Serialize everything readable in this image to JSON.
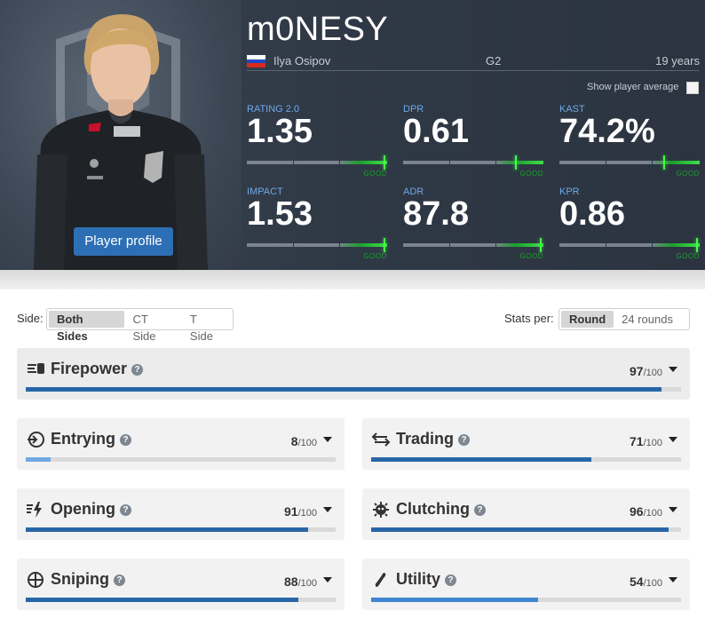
{
  "player": {
    "nickname": "m0NESY",
    "real_name": "Ilya Osipov",
    "team": "G2",
    "age": "19 years",
    "profile_button": "Player profile",
    "show_average_label": "Show player average"
  },
  "stats": [
    {
      "label": "RATING 2.0",
      "value": "1.35",
      "badge": "GOOD",
      "level": 0.99
    },
    {
      "label": "DPR",
      "value": "0.61",
      "badge": "GOOD",
      "level": 0.81
    },
    {
      "label": "KAST",
      "value": "74.2%",
      "badge": "GOOD",
      "level": 0.75
    },
    {
      "label": "IMPACT",
      "value": "1.53",
      "badge": "GOOD",
      "level": 0.99
    },
    {
      "label": "ADR",
      "value": "87.8",
      "badge": "GOOD",
      "level": 0.99
    },
    {
      "label": "KPR",
      "value": "0.86",
      "badge": "GOOD",
      "level": 0.99
    }
  ],
  "controls": {
    "side_label": "Side:",
    "side_options": [
      "Both Sides",
      "CT Side",
      "T Side"
    ],
    "side_selected": "Both Sides",
    "per_label": "Stats per:",
    "per_options": [
      "Round",
      "24 rounds"
    ],
    "per_selected": "Round"
  },
  "categories": [
    {
      "name": "Firepower",
      "score": "97",
      "max": "/100",
      "value": 97,
      "icon": "firepower-icon",
      "color": "#2866a8"
    },
    {
      "name": "Entrying",
      "score": "8",
      "max": "/100",
      "value": 8,
      "icon": "entrying-icon",
      "color": "#6fa9e0"
    },
    {
      "name": "Trading",
      "score": "71",
      "max": "/100",
      "value": 71,
      "icon": "trading-icon",
      "color": "#2866a8"
    },
    {
      "name": "Opening",
      "score": "91",
      "max": "/100",
      "value": 91,
      "icon": "opening-icon",
      "color": "#2866a8"
    },
    {
      "name": "Clutching",
      "score": "96",
      "max": "/100",
      "value": 96,
      "icon": "clutching-icon",
      "color": "#2866a8"
    },
    {
      "name": "Sniping",
      "score": "88",
      "max": "/100",
      "value": 88,
      "icon": "sniping-icon",
      "color": "#2866a8"
    },
    {
      "name": "Utility",
      "score": "54",
      "max": "/100",
      "value": 54,
      "icon": "utility-icon",
      "color": "#3f86cf"
    }
  ],
  "colors": {
    "accent": "#2866a8",
    "profile_button": "#2d6fb5",
    "good": "#3fe04a",
    "stat_label": "#6fa9e8"
  }
}
